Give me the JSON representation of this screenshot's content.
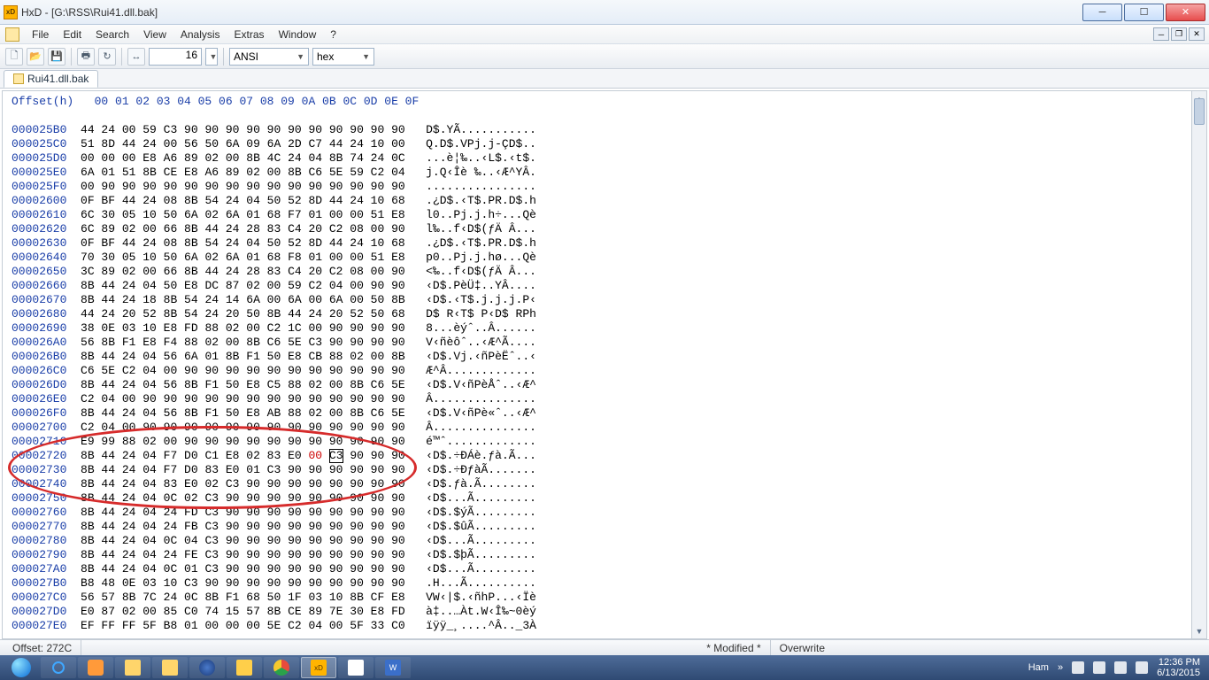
{
  "window": {
    "app_icon_label": "HxD",
    "title": "HxD - [G:\\RSS\\Rui41.dll.bak]"
  },
  "menu": {
    "items": [
      "File",
      "Edit",
      "Search",
      "View",
      "Analysis",
      "Extras",
      "Window",
      "?"
    ]
  },
  "toolbar": {
    "bytes_per_row": "16",
    "encoding": "ANSI",
    "number_base": "hex"
  },
  "tab": {
    "filename": "Rui41.dll.bak"
  },
  "hex": {
    "header_label": "Offset(h)",
    "columns": [
      "00",
      "01",
      "02",
      "03",
      "04",
      "05",
      "06",
      "07",
      "08",
      "09",
      "0A",
      "0B",
      "0C",
      "0D",
      "0E",
      "0F"
    ],
    "rows": [
      {
        "off": "000025B0",
        "b": "44 24 00 59 C3 90 90 90 90 90 90 90 90 90 90 90",
        "a": "D$.YÃ..........."
      },
      {
        "off": "000025C0",
        "b": "51 8D 44 24 00 56 50 6A 09 6A 2D C7 44 24 10 00",
        "a": "Q.D$.VPj.j-ÇD$.."
      },
      {
        "off": "000025D0",
        "b": "00 00 00 E8 A6 89 02 00 8B 4C 24 04 8B 74 24 0C",
        "a": "...è¦‰..‹L$.‹t$."
      },
      {
        "off": "000025E0",
        "b": "6A 01 51 8B CE E8 A6 89 02 00 8B C6 5E 59 C2 04",
        "a": "j.Q‹Îè ‰..‹Æ^YÂ."
      },
      {
        "off": "000025F0",
        "b": "00 90 90 90 90 90 90 90 90 90 90 90 90 90 90 90",
        "a": "................"
      },
      {
        "off": "00002600",
        "b": "0F BF 44 24 08 8B 54 24 04 50 52 8D 44 24 10 68",
        "a": ".¿D$.‹T$.PR.D$.h"
      },
      {
        "off": "00002610",
        "b": "6C 30 05 10 50 6A 02 6A 01 68 F7 01 00 00 51 E8",
        "a": "l0..Pj.j.h÷...Qè"
      },
      {
        "off": "00002620",
        "b": "6C 89 02 00 66 8B 44 24 28 83 C4 20 C2 08 00 90",
        "a": "l‰..f‹D$(ƒÄ Â..."
      },
      {
        "off": "00002630",
        "b": "0F BF 44 24 08 8B 54 24 04 50 52 8D 44 24 10 68",
        "a": ".¿D$.‹T$.PR.D$.h"
      },
      {
        "off": "00002640",
        "b": "70 30 05 10 50 6A 02 6A 01 68 F8 01 00 00 51 E8",
        "a": "p0..Pj.j.hø...Qè"
      },
      {
        "off": "00002650",
        "b": "3C 89 02 00 66 8B 44 24 28 83 C4 20 C2 08 00 90",
        "a": "<‰..f‹D$(ƒÄ Â..."
      },
      {
        "off": "00002660",
        "b": "8B 44 24 04 50 E8 DC 87 02 00 59 C2 04 00 90 90",
        "a": "‹D$.PèÜ‡..YÂ...."
      },
      {
        "off": "00002670",
        "b": "8B 44 24 18 8B 54 24 14 6A 00 6A 00 6A 00 50 8B",
        "a": "‹D$.‹T$.j.j.j.P‹"
      },
      {
        "off": "00002680",
        "b": "44 24 20 52 8B 54 24 20 50 8B 44 24 20 52 50 68",
        "a": "D$ R‹T$ P‹D$ RPh"
      },
      {
        "off": "00002690",
        "b": "38 0E 03 10 E8 FD 88 02 00 C2 1C 00 90 90 90 90",
        "a": "8...èýˆ..Â......"
      },
      {
        "off": "000026A0",
        "b": "56 8B F1 E8 F4 88 02 00 8B C6 5E C3 90 90 90 90",
        "a": "V‹ñèôˆ..‹Æ^Ã...."
      },
      {
        "off": "000026B0",
        "b": "8B 44 24 04 56 6A 01 8B F1 50 E8 CB 88 02 00 8B",
        "a": "‹D$.Vj.‹ñPèËˆ..‹"
      },
      {
        "off": "000026C0",
        "b": "C6 5E C2 04 00 90 90 90 90 90 90 90 90 90 90 90",
        "a": "Æ^Â............."
      },
      {
        "off": "000026D0",
        "b": "8B 44 24 04 56 8B F1 50 E8 C5 88 02 00 8B C6 5E",
        "a": "‹D$.V‹ñPèÅˆ..‹Æ^"
      },
      {
        "off": "000026E0",
        "b": "C2 04 00 90 90 90 90 90 90 90 90 90 90 90 90 90",
        "a": "Â..............."
      },
      {
        "off": "000026F0",
        "b": "8B 44 24 04 56 8B F1 50 E8 AB 88 02 00 8B C6 5E",
        "a": "‹D$.V‹ñPè«ˆ..‹Æ^"
      },
      {
        "off": "00002700",
        "b": "C2 04 00 90 90 90 90 90 90 90 90 90 90 90 90 90",
        "a": "Â..............."
      },
      {
        "off": "00002710",
        "b": "E9 99 88 02 00 90 90 90 90 90 90 90 90 90 90 90",
        "a": "é™ˆ............."
      },
      {
        "off": "00002720",
        "b": "8B 44 24 04 F7 D0 C1 E8 02 83 E0 00 C3 90 90 90",
        "a": "‹D$.÷ÐÁè.ƒà.Ã...",
        "edit_col": 11,
        "cursor_col": 12
      },
      {
        "off": "00002730",
        "b": "8B 44 24 04 F7 D0 83 E0 01 C3 90 90 90 90 90 90",
        "a": "‹D$.÷ÐƒàÃ......."
      },
      {
        "off": "00002740",
        "b": "8B 44 24 04 83 E0 02 C3 90 90 90 90 90 90 90 90",
        "a": "‹D$.ƒà.Ã........"
      },
      {
        "off": "00002750",
        "b": "8B 44 24 04 0C 02 C3 90 90 90 90 90 90 90 90 90",
        "a": "‹D$...Ã........."
      },
      {
        "off": "00002760",
        "b": "8B 44 24 04 24 FD C3 90 90 90 90 90 90 90 90 90",
        "a": "‹D$.$ýÃ........."
      },
      {
        "off": "00002770",
        "b": "8B 44 24 04 24 FB C3 90 90 90 90 90 90 90 90 90",
        "a": "‹D$.$ûÃ........."
      },
      {
        "off": "00002780",
        "b": "8B 44 24 04 0C 04 C3 90 90 90 90 90 90 90 90 90",
        "a": "‹D$...Ã........."
      },
      {
        "off": "00002790",
        "b": "8B 44 24 04 24 FE C3 90 90 90 90 90 90 90 90 90",
        "a": "‹D$.$þÃ........."
      },
      {
        "off": "000027A0",
        "b": "8B 44 24 04 0C 01 C3 90 90 90 90 90 90 90 90 90",
        "a": "‹D$...Ã........."
      },
      {
        "off": "000027B0",
        "b": "B8 48 0E 03 10 C3 90 90 90 90 90 90 90 90 90 90",
        "a": ".H...Ã.........."
      },
      {
        "off": "000027C0",
        "b": "56 57 8B 7C 24 0C 8B F1 68 50 1F 03 10 8B CF E8",
        "a": "VW‹|$.‹ñhP...‹Ïè"
      },
      {
        "off": "000027D0",
        "b": "E0 87 02 00 85 C0 74 15 57 8B CE 89 7E 30 E8 FD",
        "a": "à‡..…Àt.W‹Î‰~0èý"
      },
      {
        "off": "000027E0",
        "b": "EF FF FF 5F B8 01 00 00 00 5E C2 04 00 5F 33 C0",
        "a": "ïÿÿ_¸....^Â.._3À"
      }
    ]
  },
  "status": {
    "offset_label": "Offset: 272C",
    "modified": "* Modified *",
    "mode": "Overwrite"
  },
  "taskbar": {
    "user": "Ham",
    "time": "12:36 PM",
    "date": "6/13/2015"
  }
}
